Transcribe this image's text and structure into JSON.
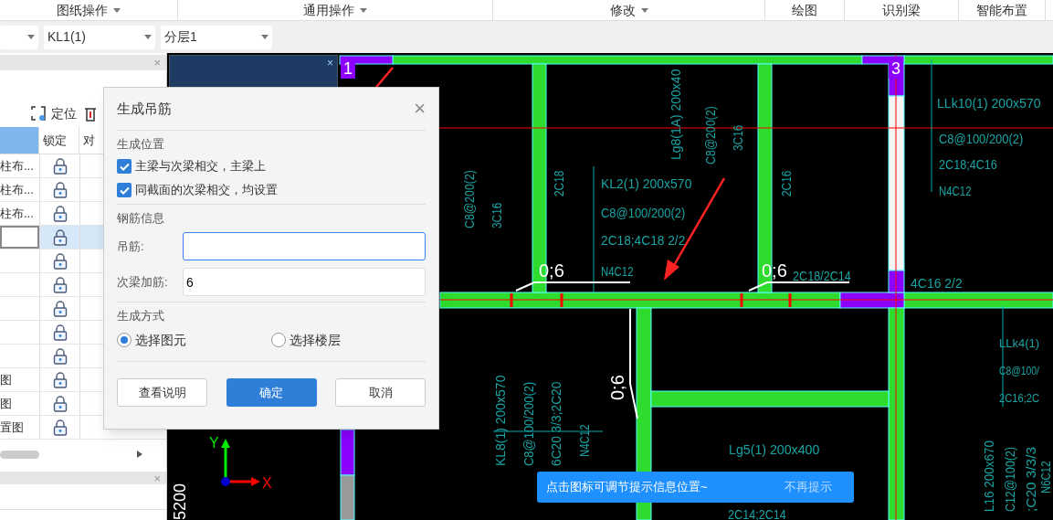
{
  "ribbon": [
    {
      "label": "图纸操作",
      "dropdown": true
    },
    {
      "label": "通用操作",
      "dropdown": true
    },
    {
      "label": "修改",
      "dropdown": true
    },
    {
      "label": "绘图",
      "dropdown": false
    },
    {
      "label": "识别梁",
      "dropdown": false
    },
    {
      "label": "智能布置",
      "dropdown": false
    }
  ],
  "toolbar": {
    "selects": [
      {
        "kind": "blank"
      },
      {
        "kind": "text",
        "value": "KL1(1)"
      },
      {
        "kind": "text",
        "value": "分层1"
      }
    ]
  },
  "left_panel": {
    "close": "×",
    "tools": [
      {
        "label": "定位"
      }
    ],
    "columns": [
      {
        "selected": true
      },
      {
        "label": "锁定",
        "selected": false
      },
      {
        "label": "对",
        "selected": false
      }
    ],
    "rows": [
      {
        "name": "柱布...",
        "locked": true,
        "selected": false
      },
      {
        "name": "柱布...",
        "locked": true,
        "selected": false
      },
      {
        "name": "柱布...",
        "locked": true,
        "selected": false
      },
      {
        "locked": true,
        "selected": true
      },
      {
        "locked": true,
        "selected": false
      },
      {
        "locked": true,
        "selected": false
      },
      {
        "locked": true,
        "selected": false
      },
      {
        "locked": true,
        "selected": false
      },
      {
        "locked": true,
        "selected": false
      },
      {
        "name": "图",
        "locked": true,
        "selected": false
      },
      {
        "name": "图",
        "locked": true,
        "selected": false
      },
      {
        "name": "置图",
        "locked": true,
        "selected": false
      }
    ],
    "properties_close": "×"
  },
  "floating_panel": {
    "close": "×"
  },
  "dialog": {
    "title": "生成吊筋",
    "close": "×",
    "sections": [
      {
        "title": "生成位置",
        "kind": "checks",
        "items": [
          {
            "label": "主梁与次梁相交，主梁上",
            "checked": true
          },
          {
            "label": "同截面的次梁相交，均设置",
            "checked": true
          }
        ]
      },
      {
        "title": "钢筋信息",
        "kind": "fields",
        "items": [
          {
            "label": "吊筋:",
            "focused": true
          },
          {
            "label": "次梁加筋:",
            "value": "6",
            "focused": false
          }
        ]
      },
      {
        "title": "生成方式",
        "kind": "radios",
        "items": [
          {
            "label": "选择图元",
            "selected": true
          },
          {
            "label": "选择楼层",
            "selected": false
          }
        ]
      }
    ],
    "buttons": [
      {
        "label": "查看说明",
        "primary": false
      },
      {
        "label": "确定",
        "primary": true
      },
      {
        "label": "取消",
        "primary": false
      }
    ]
  },
  "canvas": {
    "markers": [
      "1",
      "3"
    ],
    "labels": [
      {
        "text": "Lg8(1A) 200x40",
        "vertical": true
      },
      {
        "text": "C8@200(2)",
        "vertical": true
      },
      {
        "text": "3C16",
        "vertical": true
      },
      {
        "text": "2C18",
        "vertical": true
      },
      {
        "text": "2C16",
        "vertical": true
      },
      {
        "text": "C8@200(2)",
        "vertical": true
      },
      {
        "text": "3C16",
        "vertical": true
      },
      {
        "text": "KL2(1) 200x570",
        "vertical": false
      },
      {
        "text": "C8@100/200(2)",
        "vertical": false
      },
      {
        "text": "2C18;4C18 2/2",
        "vertical": false
      },
      {
        "text": "N4C12",
        "vertical": false
      },
      {
        "text": "LLk10(1) 200x570",
        "vertical": false
      },
      {
        "text": "C8@100/200(2)",
        "vertical": false
      },
      {
        "text": "2C18;4C16",
        "vertical": false
      },
      {
        "text": "N4C12",
        "vertical": false
      },
      {
        "text": "4C16 2/2",
        "vertical": false
      },
      {
        "text": "2C18/2C14",
        "vertical": false
      },
      {
        "text": "KL8(1) 200x570",
        "vertical": true
      },
      {
        "text": "C8@100/200(2)",
        "vertical": true
      },
      {
        "text": "6C20 3/3;2C20",
        "vertical": true
      },
      {
        "text": "N4C12",
        "vertical": true
      },
      {
        "text": "Lg5(1) 200x400",
        "vertical": false
      },
      {
        "text": "LLk4(1)",
        "vertical": false
      },
      {
        "text": "C8@100/",
        "vertical": false
      },
      {
        "text": "2C16;2C",
        "vertical": false
      },
      {
        "text": "L16 200x670",
        "vertical": true
      },
      {
        "text": "C12@100(2)",
        "vertical": true
      },
      {
        "text": ";C20 3/3/3",
        "vertical": true
      },
      {
        "text": "N6C12",
        "vertical": true
      },
      {
        "text": "2C14;2C14",
        "vertical": false
      }
    ],
    "dims": [
      {
        "text": "0;6",
        "vertical": false
      },
      {
        "text": "0;6",
        "vertical": false
      },
      {
        "text": "0;6",
        "vertical": true
      }
    ],
    "axis": {
      "y": "Y",
      "x": "X"
    },
    "ruler": "5200"
  },
  "tip": {
    "message": "点击图标可调节提示信息位置~",
    "dismiss": "不再提示"
  }
}
